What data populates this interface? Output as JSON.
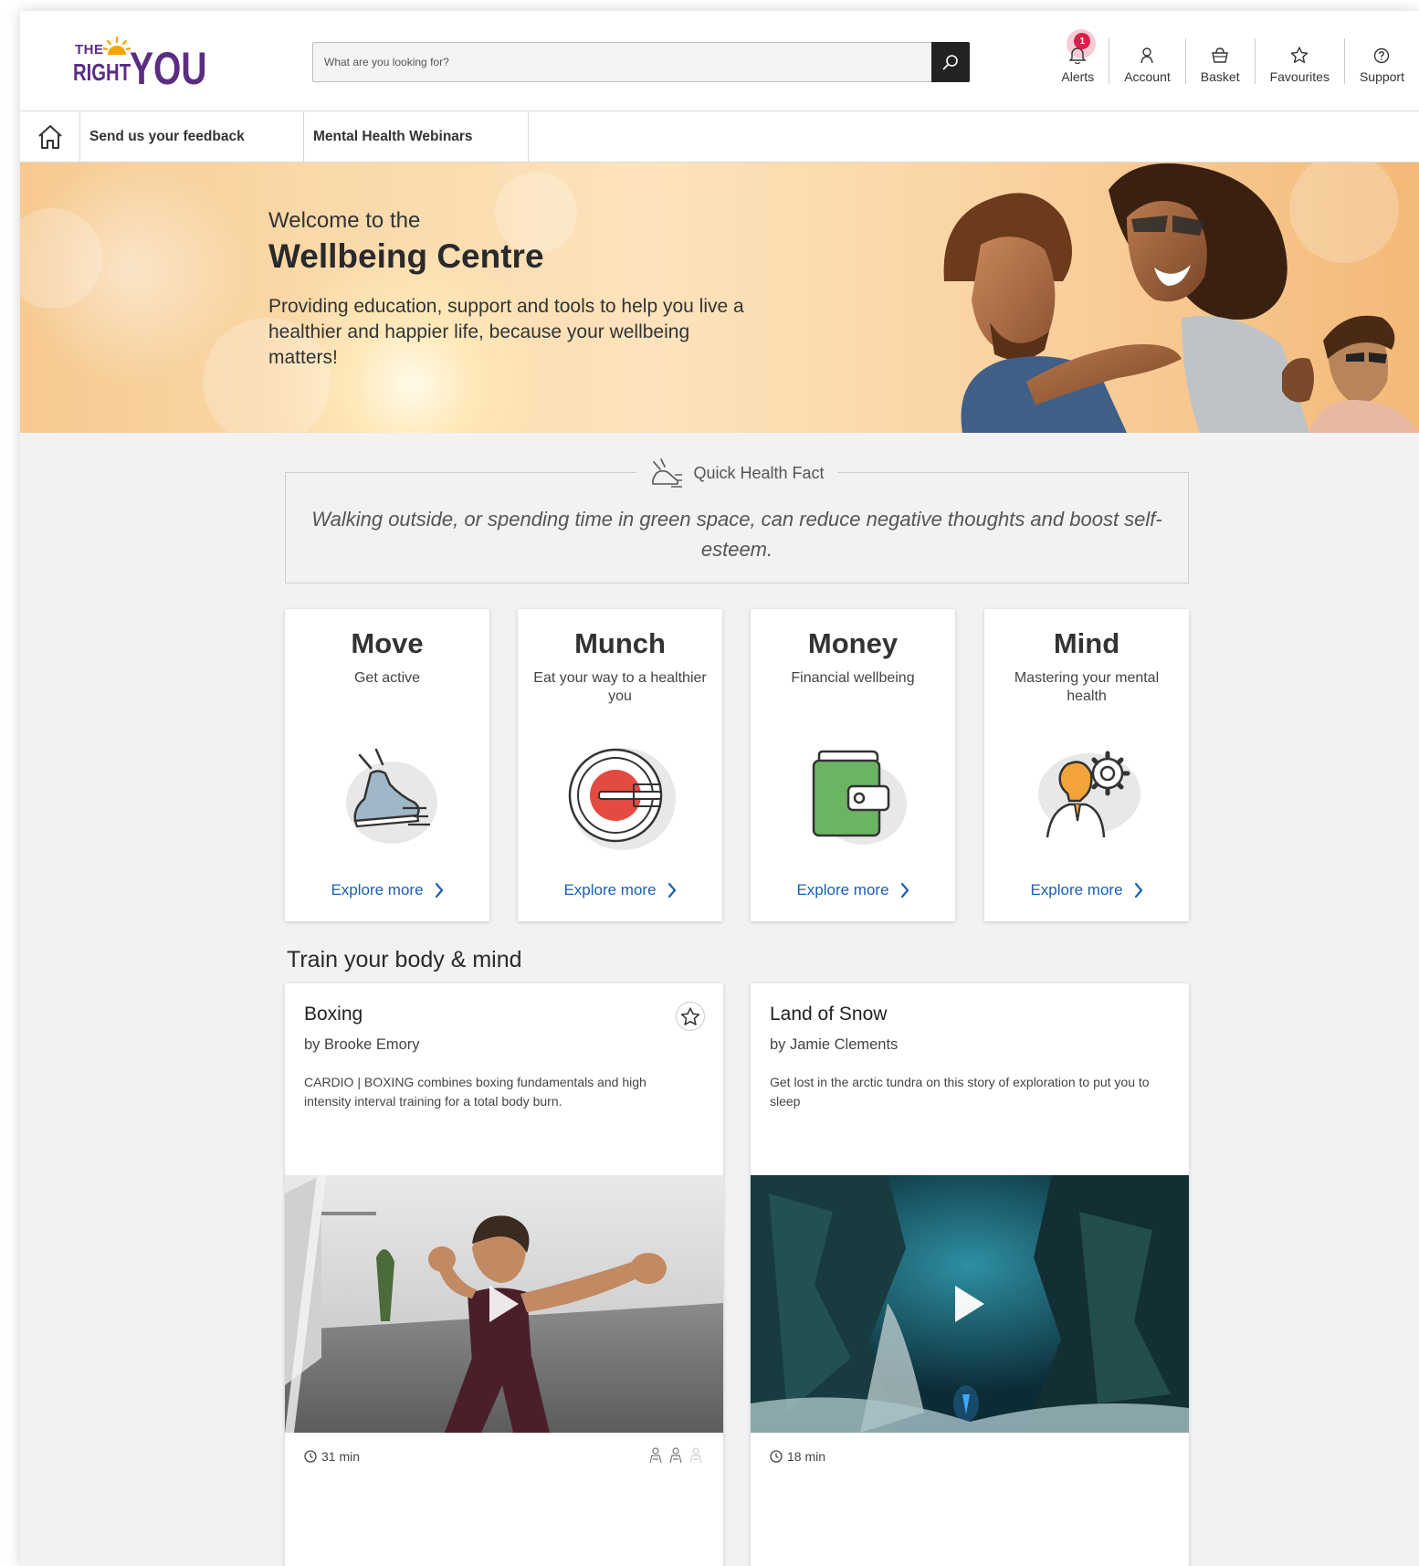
{
  "brand": {
    "logo_the": "THE",
    "logo_right": "RIGHT",
    "logo_you": "YOU"
  },
  "search": {
    "placeholder": "What are you looking for?"
  },
  "header_nav": [
    {
      "label": "Alerts",
      "icon": "bell-icon",
      "badge": "1"
    },
    {
      "label": "Account",
      "icon": "user-icon"
    },
    {
      "label": "Basket",
      "icon": "basket-icon"
    },
    {
      "label": "Favourites",
      "icon": "star-icon"
    },
    {
      "label": "Support",
      "icon": "help-icon"
    }
  ],
  "subnav": {
    "items": [
      "Send us your feedback",
      "Mental Health Webinars"
    ]
  },
  "hero": {
    "pre_title": "Welcome to the",
    "title": "Wellbeing Centre",
    "description": "Providing education, support and tools to help you live a healthier and happier life, because your wellbeing matters!"
  },
  "fact": {
    "label": "Quick Health Fact",
    "text": "Walking outside, or spending time in green space, can reduce negative thoughts and boost self-esteem."
  },
  "categories": [
    {
      "title": "Move",
      "subtitle": "Get active",
      "icon": "shoe-icon",
      "link": "Explore more"
    },
    {
      "title": "Munch",
      "subtitle": "Eat your way to a healthier you",
      "icon": "plate-fork-icon",
      "link": "Explore more"
    },
    {
      "title": "Money",
      "subtitle": "Financial wellbeing",
      "icon": "wallet-icon",
      "link": "Explore more"
    },
    {
      "title": "Mind",
      "subtitle": "Mastering your mental health",
      "icon": "mind-gear-icon",
      "link": "Explore more"
    }
  ],
  "section": {
    "title": "Train your body & mind"
  },
  "media": [
    {
      "title": "Boxing",
      "author": "by Brooke Emory",
      "description": "CARDIO | BOXING combines boxing fundamentals and high intensity interval training for a total body burn.",
      "duration": "31 min",
      "difficulty": 2,
      "difficulty_max": 3
    },
    {
      "title": "Land of Snow",
      "author": "by Jamie Clements",
      "description": "Get lost in the arctic tundra on this story of exploration to put you to sleep",
      "duration": "18 min"
    }
  ],
  "colors": {
    "brand_purple": "#5a2d82",
    "link_blue": "#1a5fb4",
    "alert_red": "#d6224a"
  }
}
